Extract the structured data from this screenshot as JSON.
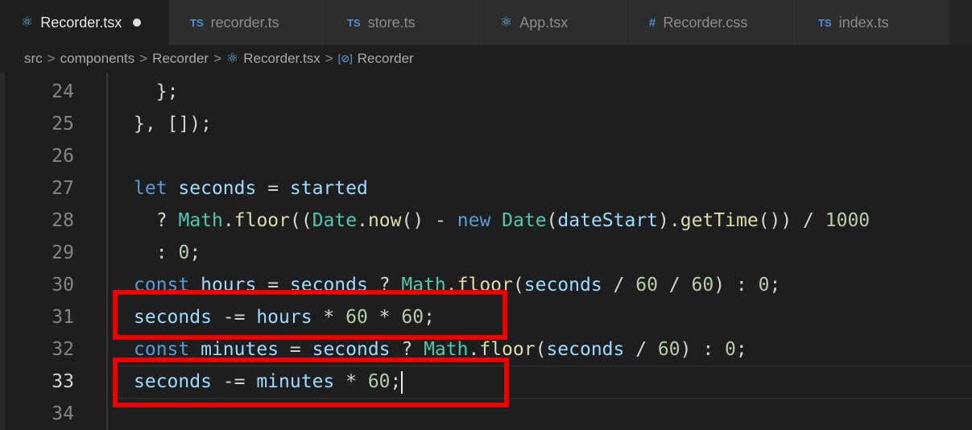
{
  "tabs": [
    {
      "label": "Recorder.tsx",
      "icon": "react-icon",
      "glyph": "⚛",
      "active": true,
      "modified": true
    },
    {
      "label": "recorder.ts",
      "icon": "typescript-icon",
      "glyph": "TS"
    },
    {
      "label": "store.ts",
      "icon": "typescript-icon",
      "glyph": "TS"
    },
    {
      "label": "App.tsx",
      "icon": "react-icon",
      "glyph": "⚛"
    },
    {
      "label": "Recorder.css",
      "icon": "css-icon",
      "glyph": "#"
    },
    {
      "label": "index.ts",
      "icon": "typescript-icon",
      "glyph": "TS"
    }
  ],
  "breadcrumb": {
    "items": [
      "src",
      "components",
      "Recorder",
      "Recorder.tsx",
      "Recorder"
    ],
    "separator": ">",
    "file_glyph": "⚛",
    "symbol_glyph": "[⊘]"
  },
  "editor": {
    "current_line": 33,
    "lines": [
      {
        "n": "24",
        "indent": "    ",
        "text": "};"
      },
      {
        "n": "25",
        "indent": "  ",
        "text": "}, []);"
      },
      {
        "n": "26",
        "indent": "",
        "text": ""
      },
      {
        "n": "27",
        "indent": "  ",
        "text": "let seconds = started"
      },
      {
        "n": "28",
        "indent": "    ",
        "text": "? Math.floor((Date.now() - new Date(dateStart).getTime()) / 1000"
      },
      {
        "n": "29",
        "indent": "    ",
        "text": ": 0;"
      },
      {
        "n": "30",
        "indent": "  ",
        "text": "const hours = seconds ? Math.floor(seconds / 60 / 60) : 0;"
      },
      {
        "n": "31",
        "indent": "  ",
        "text": "seconds -= hours * 60 * 60;"
      },
      {
        "n": "32",
        "indent": "  ",
        "text": "const minutes = seconds ? Math.floor(seconds / 60) : 0;"
      },
      {
        "n": "33",
        "indent": "  ",
        "text": "seconds -= minutes * 60;"
      },
      {
        "n": "34",
        "indent": "",
        "text": ""
      }
    ]
  },
  "highlight_color": "#ee0000"
}
